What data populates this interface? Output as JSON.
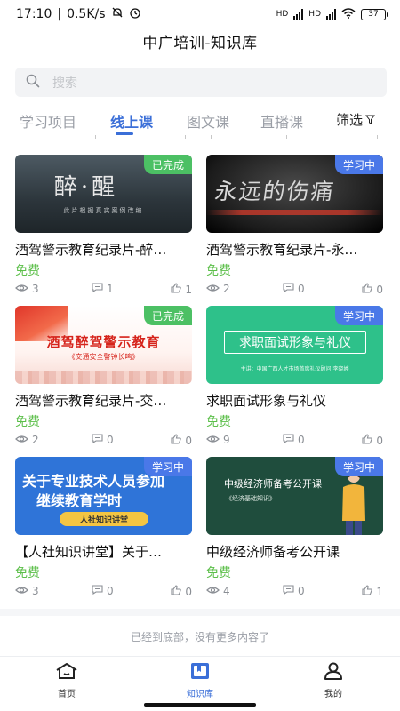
{
  "status_bar": {
    "time": "17:10",
    "speed": "0.5K/s",
    "network_1": "HD",
    "network_2": "HD",
    "battery": "37"
  },
  "header": {
    "title": "中广培训-知识库"
  },
  "search": {
    "placeholder": "搜索"
  },
  "tabs": [
    {
      "label": "学习项目",
      "active": false
    },
    {
      "label": "线上课",
      "active": true
    },
    {
      "label": "图文课",
      "active": false
    },
    {
      "label": "直播课",
      "active": false
    }
  ],
  "filter": {
    "label": "筛选"
  },
  "courses": [
    {
      "title": "酒驾警示教育纪录片-醉…",
      "status": "已完成",
      "price": "免费",
      "views": "3",
      "comments": "1",
      "likes": "1",
      "thumb_text": "醉·醒",
      "thumb_sub": "此片根据真实案例改编"
    },
    {
      "title": "酒驾警示教育纪录片-永…",
      "status": "学习中",
      "price": "免费",
      "views": "2",
      "comments": "0",
      "likes": "0",
      "thumb_text": "永远的伤痛"
    },
    {
      "title": "酒驾警示教育纪录片-交…",
      "status": "已完成",
      "price": "免费",
      "views": "2",
      "comments": "0",
      "likes": "0",
      "thumb_text": "酒驾醉驾警示教育",
      "thumb_sub": "《交通安全警钟长鸣》"
    },
    {
      "title": "求职面试形象与礼仪",
      "status": "学习中",
      "price": "免费",
      "views": "9",
      "comments": "0",
      "likes": "0",
      "thumb_text": "求职面试形象与礼仪",
      "thumb_sub": "主讲：中国广西人才市场首席礼仪顾问 李晓婷"
    },
    {
      "title": "【人社知识讲堂】关于…",
      "status": "学习中",
      "price": "免费",
      "views": "3",
      "comments": "0",
      "likes": "0",
      "thumb_line1": "关于专业技术人员参加",
      "thumb_line2": "继续教育学时",
      "thumb_pill": "人社知识讲堂"
    },
    {
      "title": "中级经济师备考公开课",
      "status": "学习中",
      "price": "免费",
      "views": "4",
      "comments": "0",
      "likes": "1",
      "thumb_text": "中级经济师备考公开课",
      "thumb_sub": "《经济基础知识》"
    }
  ],
  "end_message": "已经到底部，没有更多内容了",
  "bottom_nav": [
    {
      "label": "首页",
      "icon": "home-icon",
      "active": false
    },
    {
      "label": "知识库",
      "icon": "library-icon",
      "active": true
    },
    {
      "label": "我的",
      "icon": "profile-icon",
      "active": false
    }
  ],
  "colors": {
    "accent": "#3b6fd8",
    "status_done": "#4cc064",
    "status_learning": "#4a78e8",
    "price": "#5cbf4a"
  }
}
